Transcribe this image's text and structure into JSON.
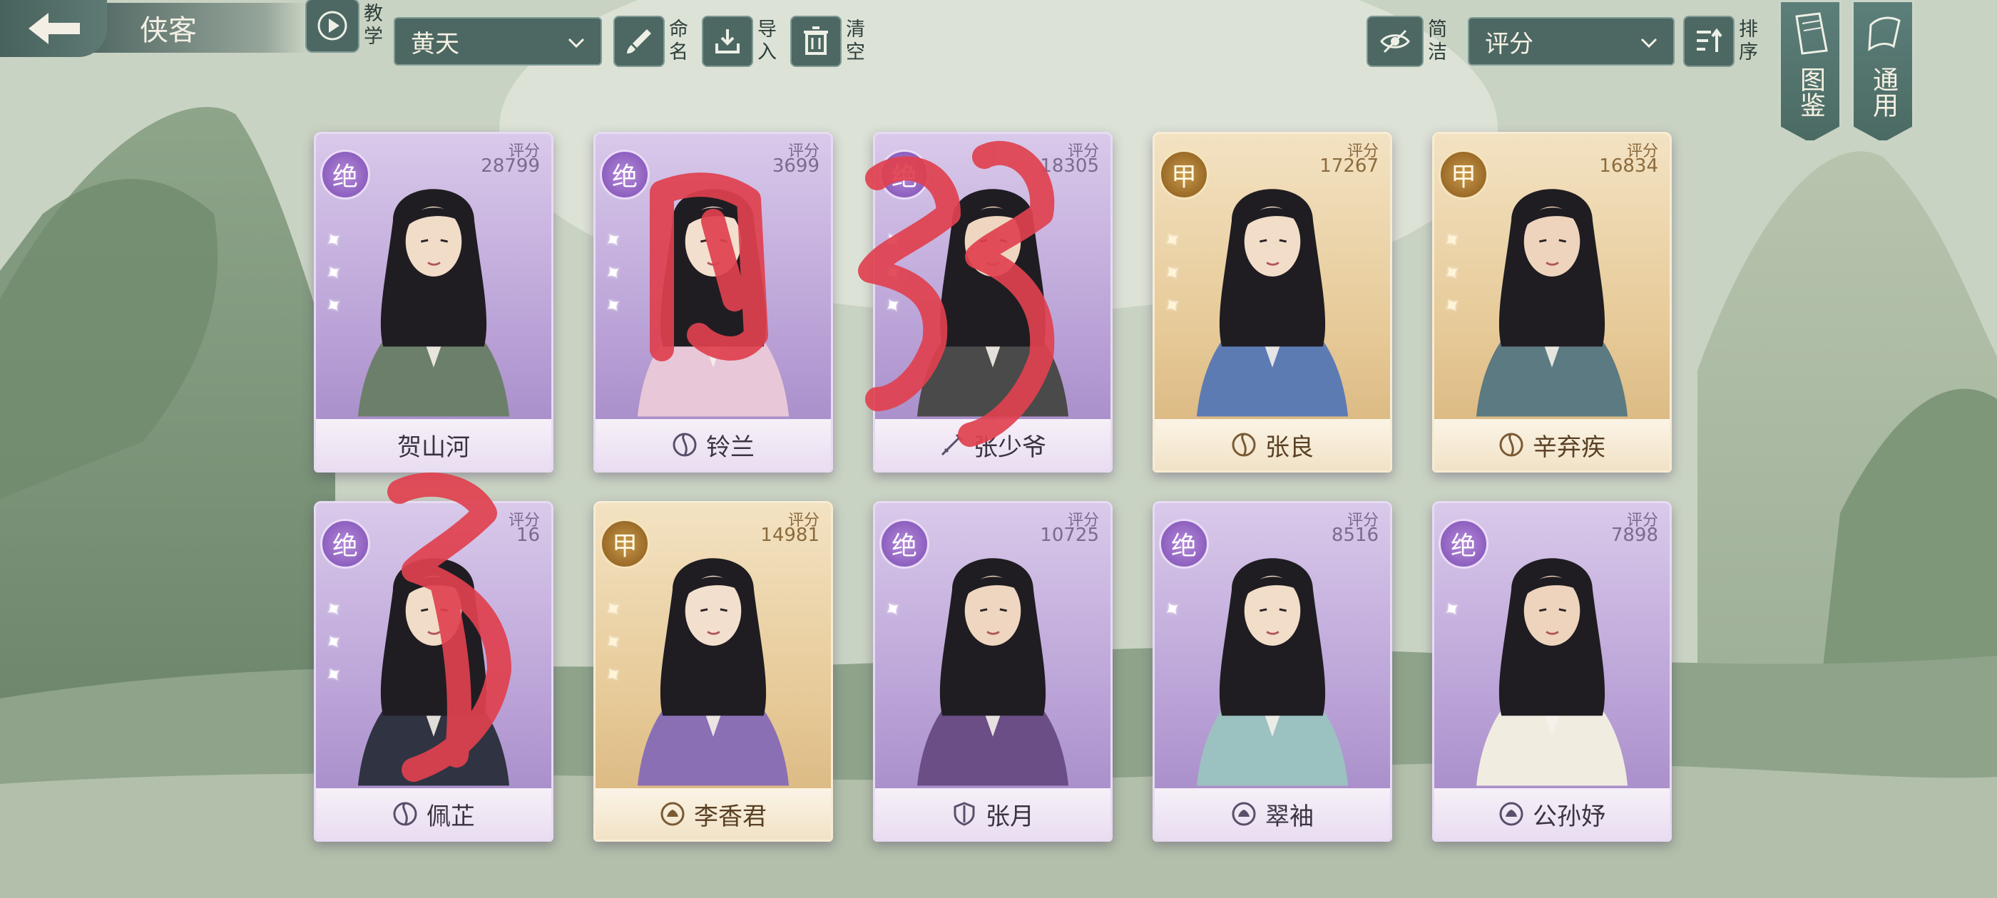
{
  "header": {
    "title": "侠客",
    "tutorial_label": "教学",
    "filter_select": "黄天",
    "rename_label": "命名",
    "import_label": "导入",
    "clear_label": "清空",
    "simple_label": "简洁",
    "sort_select": "评分",
    "sort_label": "排序"
  },
  "side_tabs": {
    "atlas": "图鉴",
    "general": "通用"
  },
  "score_label": "评分",
  "cards": [
    {
      "name": "贺山河",
      "score": "28799",
      "rank": "绝",
      "stars": 3,
      "grade": "jue",
      "sect": ""
    },
    {
      "name": "铃兰",
      "score": "3699",
      "rank": "绝",
      "stars": 3,
      "grade": "jue",
      "sect": "yinyang"
    },
    {
      "name": "张少爷",
      "score": "18305",
      "rank": "绝",
      "stars": 3,
      "grade": "jue",
      "sect": "sword"
    },
    {
      "name": "张良",
      "score": "17267",
      "rank": "甲",
      "stars": 3,
      "grade": "jia",
      "sect": "yinyang"
    },
    {
      "name": "辛弃疾",
      "score": "16834",
      "rank": "甲",
      "stars": 3,
      "grade": "jia",
      "sect": "yinyang"
    },
    {
      "name": "佩芷",
      "score": "16",
      "rank": "绝",
      "stars": 3,
      "grade": "jue",
      "sect": "yinyang"
    },
    {
      "name": "李香君",
      "score": "14981",
      "rank": "甲",
      "stars": 3,
      "grade": "jia",
      "sect": "lotus"
    },
    {
      "name": "张月",
      "score": "10725",
      "rank": "绝",
      "stars": 1,
      "grade": "jue",
      "sect": "shield"
    },
    {
      "name": "翠袖",
      "score": "8516",
      "rank": "绝",
      "stars": 1,
      "grade": "jue",
      "sect": "lotus"
    },
    {
      "name": "公孙妤",
      "score": "7898",
      "rank": "绝",
      "stars": 1,
      "grade": "jue",
      "sect": "lotus"
    }
  ],
  "colors": {
    "jue_rank": "#8d5fbf",
    "jia_rank": "#9a6a28",
    "toolbar": "#4d6863",
    "scribble": "#e0414f"
  }
}
